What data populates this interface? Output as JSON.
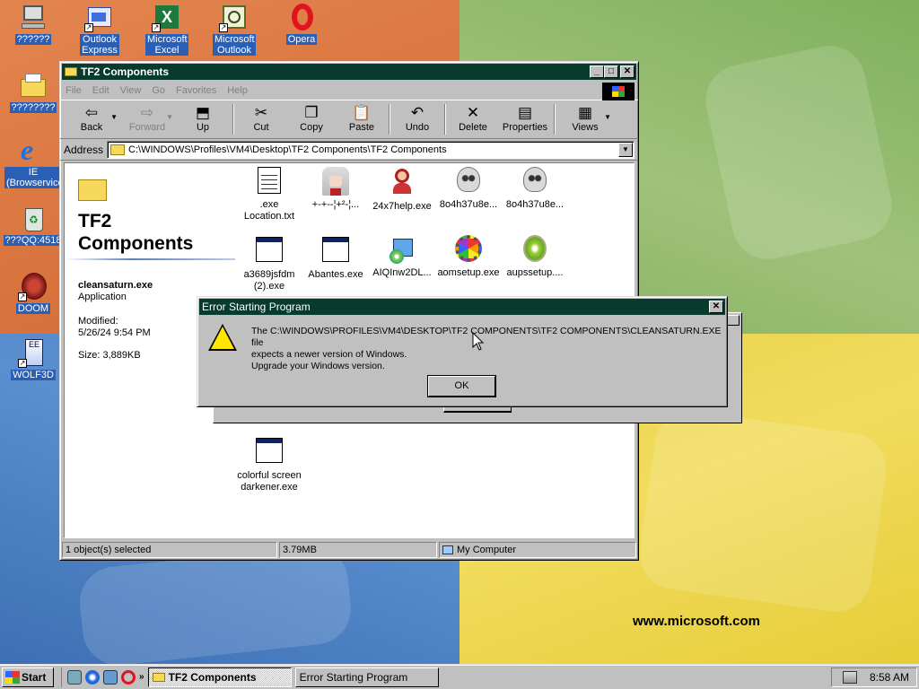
{
  "desktop": {
    "icons": [
      {
        "label": "??????",
        "icon": "computer-icon"
      },
      {
        "label": "Outlook Express",
        "icon": "outlook-express-icon"
      },
      {
        "label": "Microsoft Excel",
        "icon": "excel-icon"
      },
      {
        "label": "Microsoft Outlook",
        "icon": "outlook-icon"
      },
      {
        "label": "Opera",
        "icon": "opera-icon"
      },
      {
        "label": "????????",
        "icon": "folder-icon"
      },
      {
        "label": "IE (Browservice",
        "icon": "ie-icon"
      },
      {
        "label": "???QQ:4518",
        "icon": "recycle-bin-icon"
      },
      {
        "label": "DOOM",
        "icon": "doom-icon"
      },
      {
        "label": "WOLF3D",
        "icon": "wolf3d-icon"
      }
    ],
    "wallpaper_text": "www.microsoft.com"
  },
  "explorer": {
    "title": "TF2 Components",
    "menu": [
      "File",
      "Edit",
      "View",
      "Go",
      "Favorites",
      "Help"
    ],
    "toolbar": {
      "back": "Back",
      "forward": "Forward",
      "up": "Up",
      "cut": "Cut",
      "copy": "Copy",
      "paste": "Paste",
      "undo": "Undo",
      "delete": "Delete",
      "properties": "Properties",
      "views": "Views"
    },
    "address_label": "Address",
    "address_value": "C:\\WINDOWS\\Profiles\\VM4\\Desktop\\TF2 Components\\TF2 Components",
    "folder_title": "TF2 Components",
    "selected": {
      "name": "cleansaturn.exe",
      "type": "Application",
      "modified_label": "Modified:",
      "modified_value": "5/26/24 9:54 PM",
      "size": "Size: 3,889KB"
    },
    "files": [
      {
        "name": ".exe Location.txt",
        "icon": "text-file-icon"
      },
      {
        "name": "+-+--¦+²-¦...",
        "icon": "anime-image-icon"
      },
      {
        "name": "24x7help.exe",
        "icon": "person-icon"
      },
      {
        "name": "8o4h37u8e...",
        "icon": "skull-icon"
      },
      {
        "name": "8o4h37u8e...",
        "icon": "skull-icon"
      },
      {
        "name": "a3689jsfdm (2).exe",
        "icon": "application-icon"
      },
      {
        "name": "Abantes.exe",
        "icon": "application-icon"
      },
      {
        "name": "AIQInw2DL...",
        "icon": "installer-icon"
      },
      {
        "name": "aomsetup.exe",
        "icon": "gear-icon"
      },
      {
        "name": "aupssetup....",
        "icon": "shield-icon"
      },
      {
        "name": "colorful screen darkener.exe",
        "icon": "application-icon"
      }
    ],
    "status": {
      "selected": "1 object(s) selected",
      "size": "3.79MB",
      "zone": "My Computer"
    }
  },
  "dialog": {
    "title": "Error Starting Program",
    "line1": "The C:\\WINDOWS\\PROFILES\\VM4\\DESKTOP\\TF2 COMPONENTS\\TF2 COMPONENTS\\CLEANSATURN.EXE file",
    "line2": "expects a newer version of Windows.",
    "line3": "Upgrade your Windows version.",
    "ok": "OK"
  },
  "taskbar": {
    "start": "Start",
    "tasks": [
      "TF2 Components",
      "Error Starting Program"
    ],
    "clock": "8:58 AM"
  }
}
